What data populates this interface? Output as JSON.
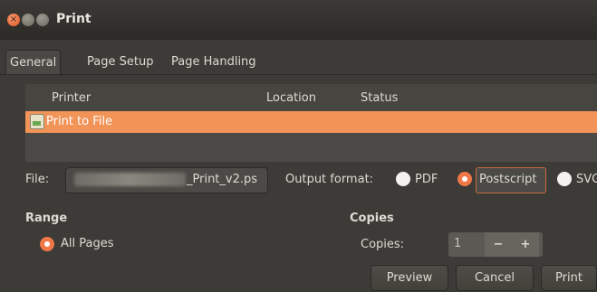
{
  "window": {
    "title": "Print"
  },
  "tabs": [
    "General",
    "Page Setup",
    "Page Handling"
  ],
  "printers": {
    "columns": [
      "Printer",
      "Location",
      "Status"
    ],
    "rows": [
      {
        "name": "Print to File",
        "location": "",
        "status": ""
      }
    ]
  },
  "file": {
    "label": "File:",
    "suffix": "_Print_v2.ps"
  },
  "output_format": {
    "label": "Output format:",
    "options": [
      "PDF",
      "Postscript",
      "SVG"
    ],
    "selected": "Postscript"
  },
  "range": {
    "heading": "Range",
    "option": "All Pages"
  },
  "copies": {
    "heading": "Copies",
    "label": "Copies:",
    "value": "1",
    "minus": "−",
    "plus": "+"
  },
  "buttons": {
    "preview": "Preview",
    "cancel": "Cancel",
    "print": "Print"
  },
  "colors": {
    "accent": "#f07746",
    "selection": "#f29358"
  }
}
